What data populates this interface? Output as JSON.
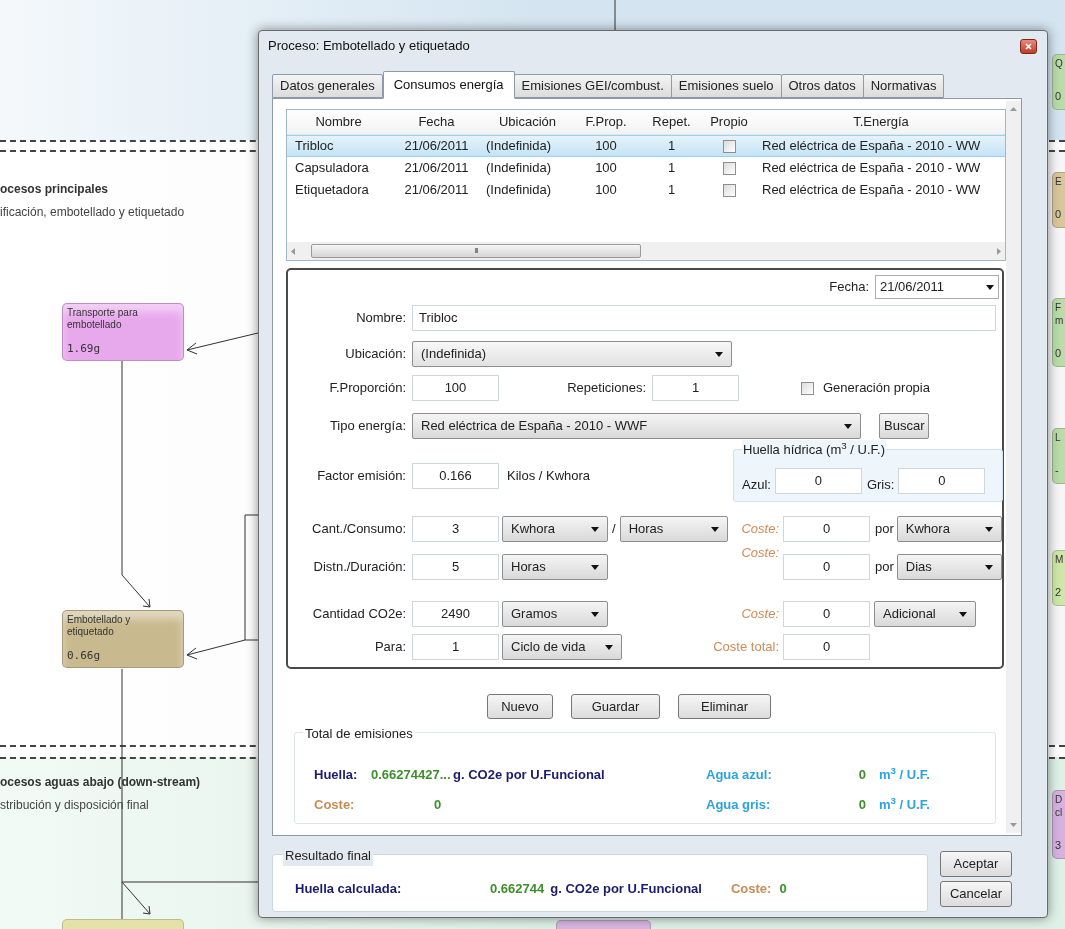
{
  "diagram": {
    "sections": [
      {
        "title": "ocesos principales",
        "subtitle": "ificación, embotellado y etiquetado"
      },
      {
        "title": "ocesos aguas abajo (down-stream)",
        "subtitle": "stribución y disposición final"
      }
    ],
    "nodes": [
      {
        "name": "Transporte para embotellado",
        "value": "1.69g",
        "color": "#e8a8ec"
      },
      {
        "name": "Embotellado y etiquetado",
        "value": "0.66g",
        "color": "#c9b98e"
      }
    ],
    "edge_nodes": [
      {
        "lines": [
          "Q"
        ],
        "value": "0",
        "color": "#b9dca9"
      },
      {
        "lines": [
          "E"
        ],
        "value": "0",
        "color": "#d8c79c"
      },
      {
        "lines": [
          "F",
          "m"
        ],
        "value": "0",
        "color": "#b9dca9"
      },
      {
        "lines": [
          "L"
        ],
        "value": "-",
        "color": "#b9dca9"
      },
      {
        "lines": [
          "M"
        ],
        "value": "2",
        "color": "#cfe6a9"
      },
      {
        "lines": [
          "D",
          "cl"
        ],
        "value": "3",
        "color": "#d6b2e0"
      }
    ]
  },
  "window": {
    "title": "Proceso: Embotellado y etiquetado"
  },
  "tabs": [
    {
      "label": "Datos generales",
      "selected": false
    },
    {
      "label": "Consumos energía",
      "selected": true
    },
    {
      "label": "Emisiones GEI/combust.",
      "selected": false
    },
    {
      "label": "Emisiones suelo",
      "selected": false
    },
    {
      "label": "Otros datos",
      "selected": false
    },
    {
      "label": "Normativas",
      "selected": false
    }
  ],
  "table": {
    "columns": [
      "Nombre",
      "Fecha",
      "Ubicación",
      "F.Prop.",
      "Repet.",
      "Propio",
      "T.Energía"
    ],
    "rows": [
      {
        "nombre": "Tribloc",
        "fecha": "21/06/2011",
        "ubicacion": "(Indefinida)",
        "f_prop": "100",
        "repet": "1",
        "propio": false,
        "t_energia": "Red eléctrica de España - 2010 - WW",
        "selected": true
      },
      {
        "nombre": "Capsuladora",
        "fecha": "21/06/2011",
        "ubicacion": "(Indefinida)",
        "f_prop": "100",
        "repet": "1",
        "propio": false,
        "t_energia": "Red eléctrica de España - 2010 - WW",
        "selected": false
      },
      {
        "nombre": "Etiquetadora",
        "fecha": "21/06/2011",
        "ubicacion": "(Indefinida)",
        "f_prop": "100",
        "repet": "1",
        "propio": false,
        "t_energia": "Red eléctrica de España - 2010 - WW",
        "selected": false
      }
    ],
    "scroll_grip": "III"
  },
  "form": {
    "fecha": {
      "label": "Fecha:",
      "value": "21/06/2011"
    },
    "nombre": {
      "label": "Nombre:",
      "value": "Tribloc"
    },
    "ubicacion": {
      "label": "Ubicación:",
      "value": "(Indefinida)"
    },
    "f_proporcion": {
      "label": "F.Proporción:",
      "value": "100"
    },
    "repeticiones": {
      "label": "Repeticiones:",
      "value": "1"
    },
    "generacion_propia": {
      "label": "Generación propia",
      "checked": false
    },
    "tipo_energia": {
      "label": "Tipo energía:",
      "value": "Red eléctrica de España - 2010 - WWF"
    },
    "buscar_button": "Buscar",
    "huella_hidrica": {
      "title": "Huella hídrica (m$^{3}$ / U.F.)",
      "azul_label": "Azul:",
      "azul": "0",
      "gris_label": "Gris:",
      "gris": "0"
    },
    "factor_emision": {
      "label": "Factor emisión:",
      "value": "0.166",
      "unit": "Kilos / Kwhora"
    },
    "cant_consumo": {
      "label": "Cant./Consumo:",
      "value": "3",
      "unit": "Kwhora",
      "separator": "/",
      "per": "Horas"
    },
    "distn_duracion": {
      "label": "Distn./Duración:",
      "value": "5",
      "unit": "Horas"
    },
    "cantidad_co2e": {
      "label": "Cantidad CO2e:",
      "value": "2490",
      "unit": "Gramos"
    },
    "para": {
      "label": "Para:",
      "value": "1",
      "unit": "Ciclo de vida"
    },
    "coste_consumo": {
      "label": "Coste:",
      "value": "0",
      "por": "por",
      "unit": "Kwhora"
    },
    "coste_duracion": {
      "label": "Coste:",
      "value": "0",
      "por": "por",
      "unit": "Dias"
    },
    "coste_adicional": {
      "label": "Coste:",
      "value": "0",
      "unit": "Adicional"
    },
    "coste_total": {
      "label": "Coste total:",
      "value": "0"
    }
  },
  "buttons": [
    "Nuevo",
    "Guardar",
    "Eliminar"
  ],
  "total_emisiones": {
    "title": "Total de emisiones",
    "huella_label": "Huella:",
    "huella": "0.66274427...",
    "huella_unit": "g. CO2e por U.Funcional",
    "coste_label": "Coste:",
    "coste": "0",
    "agua_azul_label": "Agua azul:",
    "agua_azul": "0",
    "agua_azul_unit": "m$^{3}$ / U.F.",
    "agua_gris_label": "Agua gris:",
    "agua_gris": "0",
    "agua_gris_unit": "m$^{3}$ / U.F."
  },
  "resultado_final": {
    "title": "Resultado final",
    "huella_label": "Huella calculada:",
    "huella": "0.662744",
    "huella_unit": "g. CO2e por U.Funcional",
    "coste_label": "Coste:",
    "coste": "0"
  },
  "dialog_buttons": [
    "Aceptar",
    "Cancelar"
  ]
}
